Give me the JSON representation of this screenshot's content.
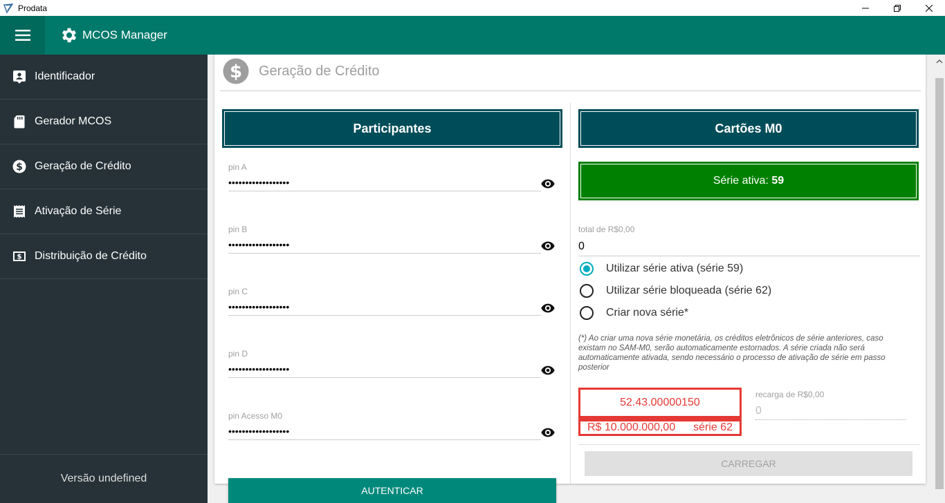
{
  "window": {
    "title": "Prodata"
  },
  "appbar": {
    "title": "MCOS Manager"
  },
  "sidebar": {
    "items": [
      {
        "label": "Identificador",
        "icon": "badge-icon"
      },
      {
        "label": "Gerador MCOS",
        "icon": "sd-card-icon"
      },
      {
        "label": "Geração de Crédito",
        "icon": "dollar-icon"
      },
      {
        "label": "Ativação de Série",
        "icon": "receipt-icon"
      },
      {
        "label": "Distribuição de Crédito",
        "icon": "money-icon"
      }
    ],
    "version": "Versão undefined"
  },
  "page": {
    "title": "Geração de Crédito"
  },
  "participants": {
    "header": "Participantes",
    "fields": [
      {
        "label": "pin A",
        "value": "••••••••••••••••••"
      },
      {
        "label": "pin B",
        "value": "••••••••••••••••••"
      },
      {
        "label": "pin C",
        "value": "••••••••••••••••••"
      },
      {
        "label": "pin D",
        "value": "••••••••••••••••••"
      },
      {
        "label": "pin Acesso M0",
        "value": "••••••••••••••••••"
      }
    ],
    "auth_button": "AUTENTICAR"
  },
  "cards": {
    "header": "Cartões M0",
    "serie_ativa_label": "Série ativa:",
    "serie_ativa_value": "59",
    "total_label": "total de R$0,00",
    "total_value": "0",
    "options": [
      {
        "label": "Utilizar série ativa (série 59)",
        "selected": true
      },
      {
        "label": "Utilizar série bloqueada (série 62)",
        "selected": false
      },
      {
        "label": "Criar nova série*",
        "selected": false
      }
    ],
    "note": "(*) Ao criar uma nova série monetária, os créditos eletrônicos de série anteriores, caso existam no SAM-M0, serão automaticamente estornados. A série criada não será automaticamente ativada, sendo necessário o processo de ativação de série em passo posterior",
    "card_id": "52.43.00000150",
    "card_amount": "R$ 10.000.000,00",
    "card_serie": "série 62",
    "recarga_label": "recarga de R$0,00",
    "recarga_value": "0",
    "load_button": "CARREGAR"
  },
  "colors": {
    "appbar": "#00796b",
    "sidebar": "#263238",
    "section_header": "#004d5a",
    "serie_active": "#008000",
    "alert": "#e53935",
    "accent": "#00acc1"
  }
}
